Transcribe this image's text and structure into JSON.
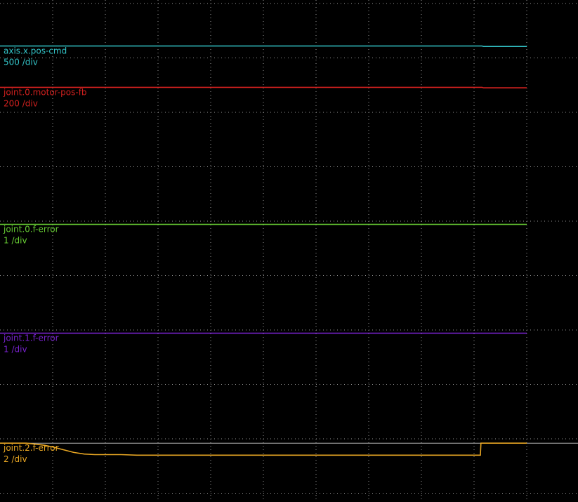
{
  "chart_data": {
    "type": "line",
    "chart_kind": "oscilloscope",
    "background": "#000000",
    "grid": true,
    "grid_style": "dotted",
    "grid_color": "#9a9a9a",
    "grid_divisions": {
      "x": 10,
      "y": 9
    },
    "legend": "left-inline",
    "series": [
      {
        "name": "axis.x.pos-cmd",
        "scale": "500 /div",
        "color": "#33c4c8",
        "offset_div": 0.78,
        "points": [
          [
            0,
            0
          ],
          [
            9.15,
            0
          ],
          [
            9.18,
            -0.01
          ],
          [
            10,
            -0.01
          ]
        ]
      },
      {
        "name": "joint.0.motor-pos-fb",
        "scale": "200 /div",
        "color": "#d0201e",
        "offset_div": 1.54,
        "points": [
          [
            0,
            0
          ],
          [
            9.15,
            0
          ],
          [
            9.18,
            -0.01
          ],
          [
            10,
            -0.01
          ]
        ]
      },
      {
        "name": "joint.0.f-error",
        "scale": "1 /div",
        "color": "#66cc33",
        "offset_div": 4.06,
        "points": [
          [
            0,
            0
          ],
          [
            10,
            0
          ]
        ]
      },
      {
        "name": "joint.1.f-error",
        "scale": "1 /div",
        "color": "#7722cc",
        "offset_div": 6.06,
        "points": [
          [
            0,
            0
          ],
          [
            10,
            0
          ]
        ]
      },
      {
        "name": "joint.2.f-error",
        "scale": "2 /div",
        "color": "#e8a623",
        "offset_div": 8.08,
        "points": [
          [
            0,
            0
          ],
          [
            0.5,
            0.0
          ],
          [
            0.7,
            -0.02
          ],
          [
            0.85,
            -0.04
          ],
          [
            1.0,
            -0.07
          ],
          [
            1.2,
            -0.12
          ],
          [
            1.4,
            -0.17
          ],
          [
            1.6,
            -0.2
          ],
          [
            1.8,
            -0.21
          ],
          [
            2.0,
            -0.21
          ],
          [
            2.3,
            -0.21
          ],
          [
            2.6,
            -0.22
          ],
          [
            4.0,
            -0.22
          ],
          [
            6.0,
            -0.22
          ],
          [
            8.0,
            -0.22
          ],
          [
            9.12,
            -0.22
          ],
          [
            9.13,
            0
          ],
          [
            10,
            0
          ]
        ]
      }
    ],
    "zero_line": {
      "color": "#b8b8b8",
      "offset_div": 8.08
    }
  }
}
